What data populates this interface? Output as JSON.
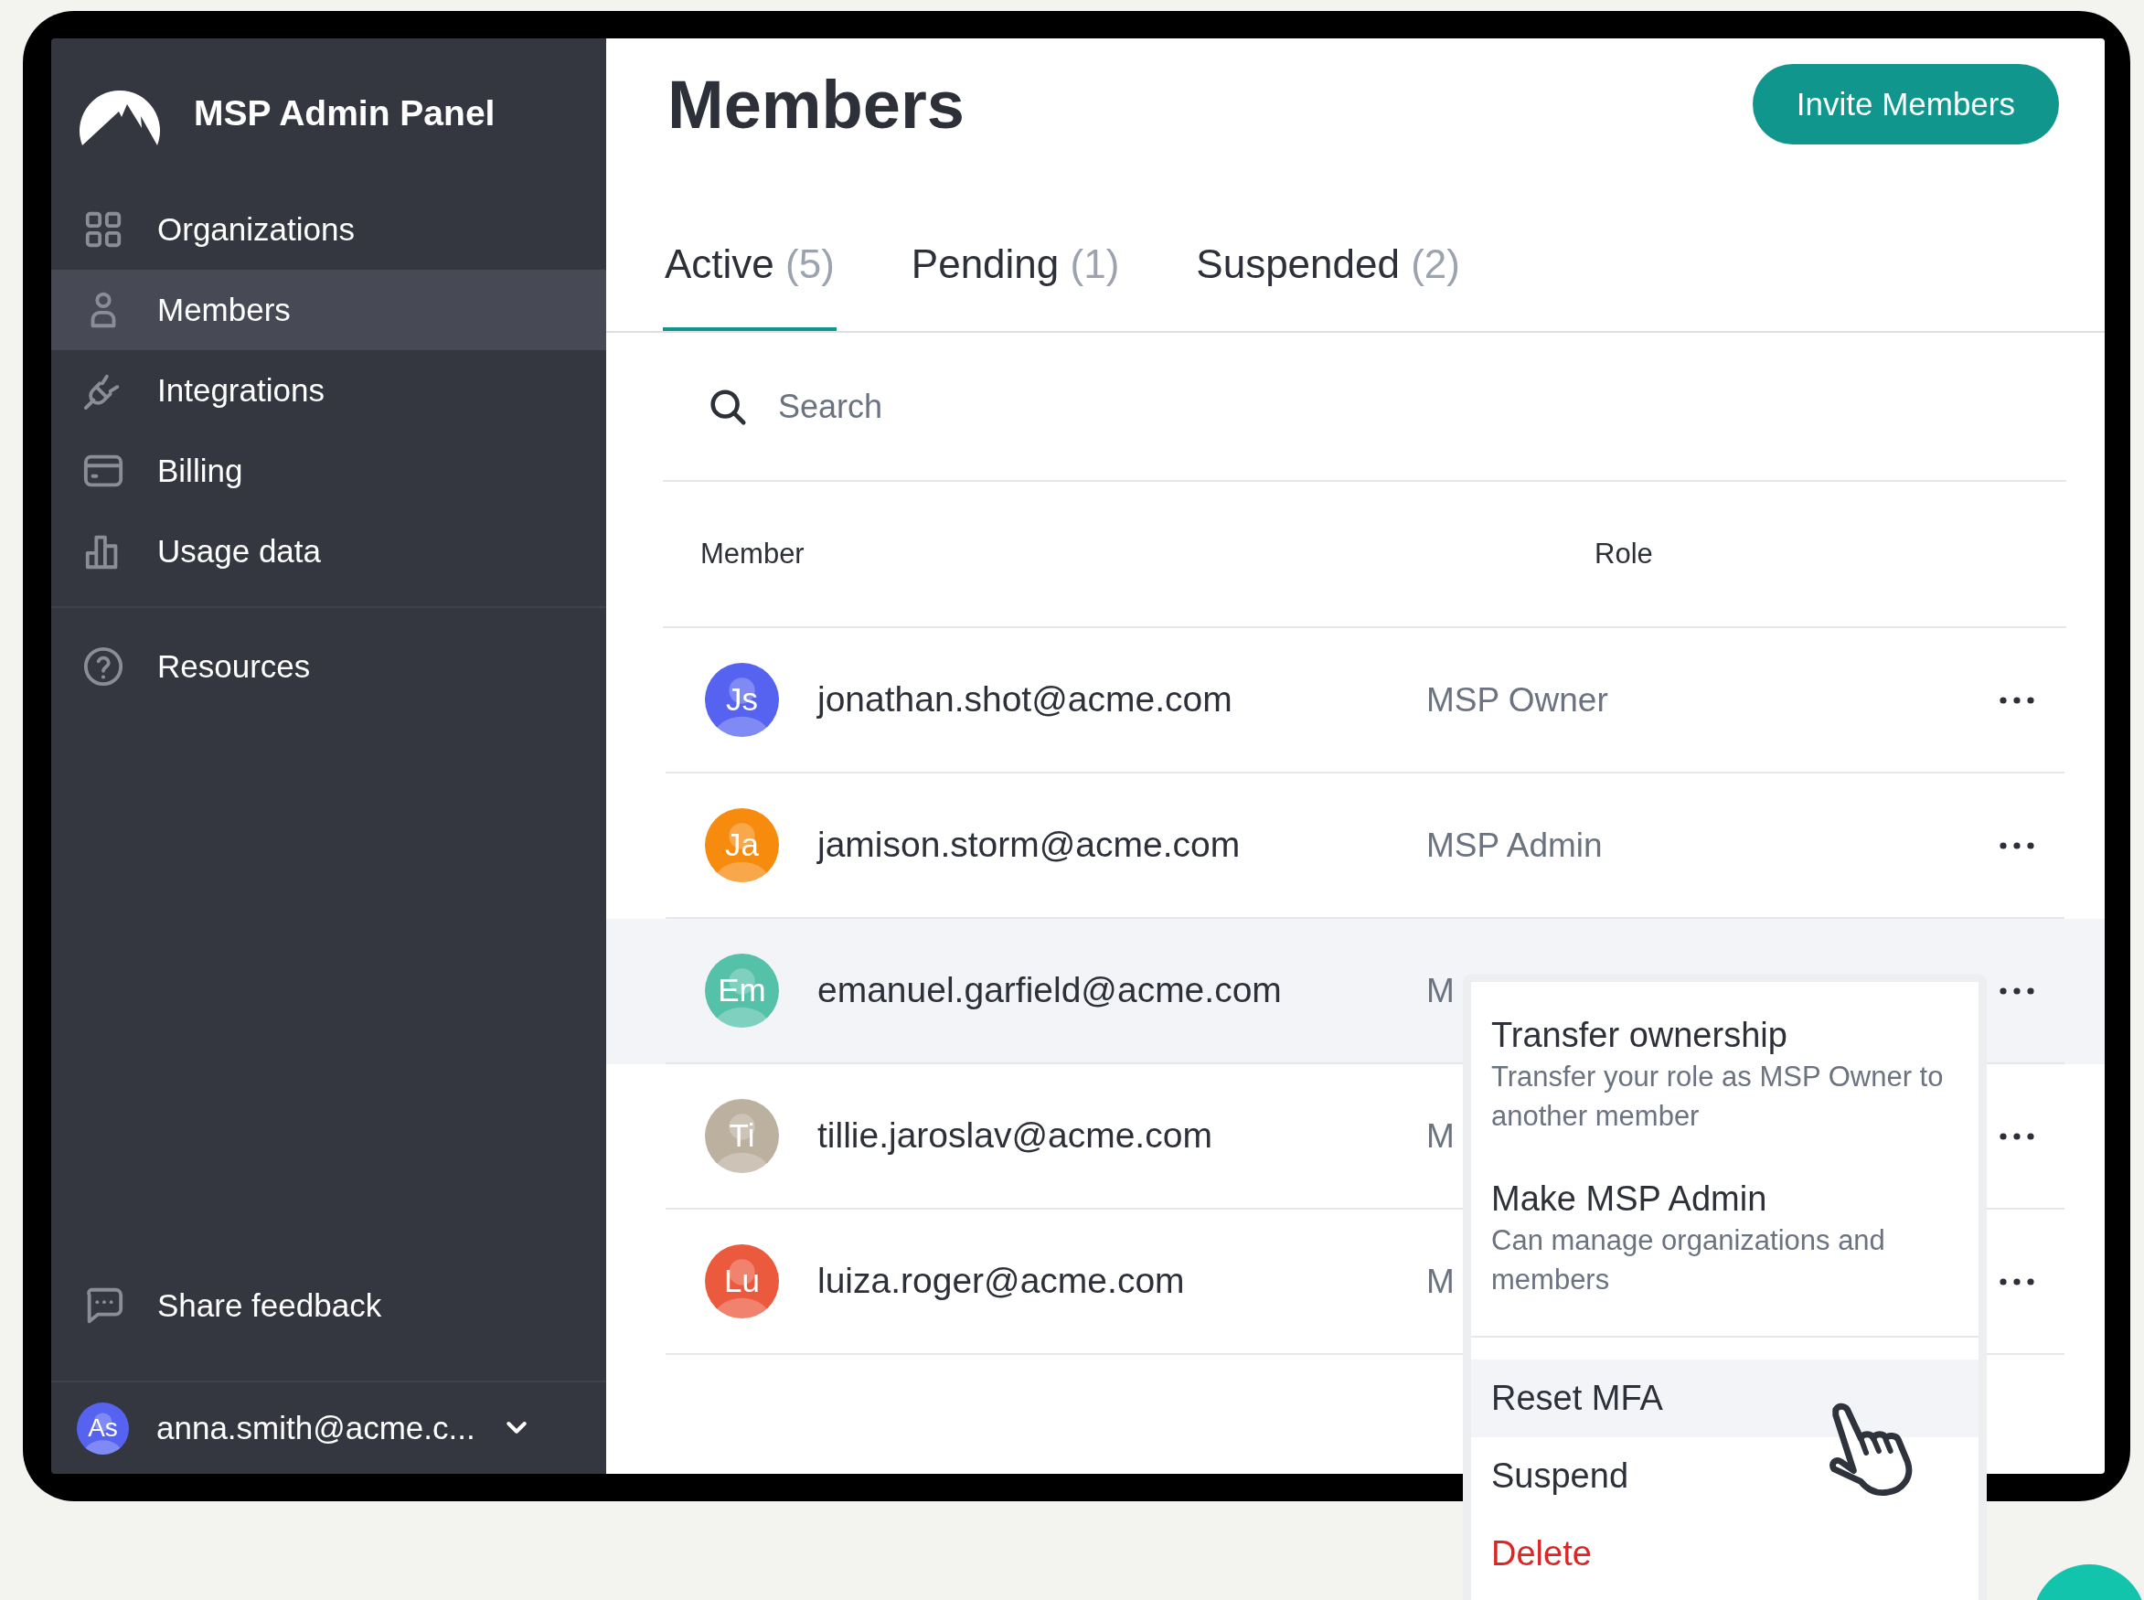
{
  "sidebar": {
    "title": "MSP Admin Panel",
    "items": [
      {
        "label": "Organizations",
        "selected": false
      },
      {
        "label": "Members",
        "selected": true
      },
      {
        "label": "Integrations",
        "selected": false
      },
      {
        "label": "Billing",
        "selected": false
      },
      {
        "label": "Usage data",
        "selected": false
      }
    ],
    "secondary_items": [
      {
        "label": "Resources",
        "selected": false
      }
    ],
    "feedback": {
      "label": "Share feedback"
    },
    "user": {
      "initials": "As",
      "email": "anna.smith@acme.c...",
      "color": "#5563f0"
    }
  },
  "header": {
    "title": "Members",
    "invite_button": "Invite Members"
  },
  "tabs": [
    {
      "label": "Active",
      "count": "(5)",
      "selected": true
    },
    {
      "label": "Pending",
      "count": "(1)",
      "selected": false
    },
    {
      "label": "Suspended",
      "count": "(2)",
      "selected": false
    }
  ],
  "search": {
    "placeholder": "Search"
  },
  "table": {
    "columns": [
      "Member",
      "Role"
    ],
    "rows": [
      {
        "initials": "Js",
        "color": "#5563f0",
        "email": "jonathan.shot@acme.com",
        "role": "MSP Owner",
        "highlighted": false
      },
      {
        "initials": "Ja",
        "color": "#f68b0e",
        "email": "jamison.storm@acme.com",
        "role": "MSP Admin",
        "highlighted": false
      },
      {
        "initials": "Em",
        "color": "#55c1a8",
        "email": "emanuel.garfield@acme.com",
        "role": "M",
        "highlighted": true
      },
      {
        "initials": "Ti",
        "color": "#bcb09f",
        "email": "tillie.jaroslav@acme.com",
        "role": "M",
        "highlighted": false
      },
      {
        "initials": "Lu",
        "color": "#ec5a3e",
        "email": "luiza.roger@acme.com",
        "role": "M",
        "highlighted": false
      }
    ]
  },
  "row_menu": {
    "items": [
      {
        "kind": "described",
        "label": "Transfer ownership",
        "description": "Transfer your role as MSP Owner to another member",
        "highlighted": false
      },
      {
        "kind": "described",
        "label": "Make MSP Admin",
        "description": "Can manage organizations and members",
        "highlighted": false
      },
      {
        "kind": "action",
        "label": "Reset MFA",
        "highlighted": true
      },
      {
        "kind": "action",
        "label": "Suspend",
        "highlighted": false
      },
      {
        "kind": "danger",
        "label": "Delete",
        "highlighted": false
      }
    ]
  }
}
